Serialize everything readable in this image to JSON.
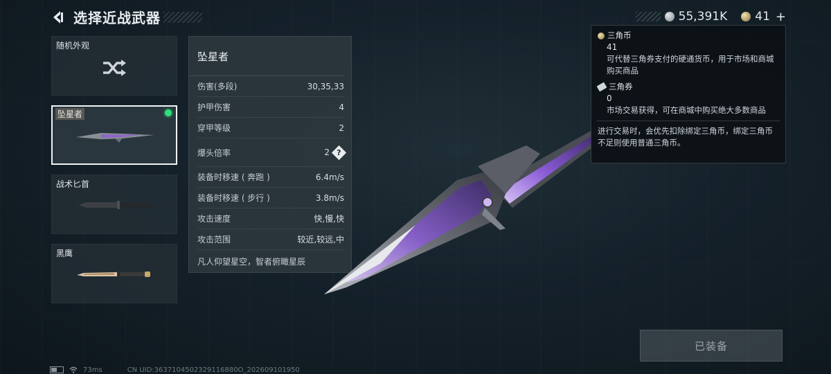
{
  "header": {
    "title": "选择近战武器"
  },
  "currency": {
    "silver_amount": "55,391K",
    "gold_amount": "41",
    "add_label": "+"
  },
  "weapons": [
    {
      "label": "随机外观"
    },
    {
      "label": "坠星者",
      "equipped": true
    },
    {
      "label": "战术匕首"
    },
    {
      "label": "黑鹰"
    }
  ],
  "stats": {
    "name": "坠星者",
    "rows": [
      {
        "label": "伤害(多段)",
        "value": "30,35,33"
      },
      {
        "label": "护甲伤害",
        "value": "4"
      },
      {
        "label": "穿甲等级",
        "value": "2"
      },
      {
        "label": "爆头倍率",
        "value": "2"
      },
      {
        "label": "装备时移速 ( 奔跑 )",
        "value": "6.4m/s"
      },
      {
        "label": "装备时移速 ( 步行 )",
        "value": "3.8m/s"
      },
      {
        "label": "攻击速度",
        "value": "快,慢,快"
      },
      {
        "label": "攻击范围",
        "value": "较近,较远,中"
      }
    ],
    "motto": "凡人仰望星空，智者俯瞰星辰",
    "help_glyph": "?"
  },
  "tooltip": {
    "coin_title": "三角币",
    "coin_amount": "41",
    "coin_desc": "可代替三角券支付的硬通货币，用于市场和商城购买商品",
    "ticket_title": "三角券",
    "ticket_amount": "0",
    "ticket_desc": "市场交易获得，可在商城中购买绝大多数商品",
    "note": "进行交易时，会优先扣除绑定三角币，绑定三角币不足则使用普通三角币。"
  },
  "equip_button": {
    "label": "已装备"
  },
  "status": {
    "ping": "73ms",
    "uid": "CN UID:3637104502329116880O_202609101950"
  },
  "colors": {
    "equipped_dot": "#2ee07a",
    "knife_accent": "#8a5cd6"
  },
  "icons": [
    "back-arrow-icon",
    "silver-coin-icon",
    "gold-coin-icon",
    "shuffle-icon",
    "help-diamond-icon",
    "ticket-icon",
    "battery-icon",
    "wifi-icon"
  ]
}
